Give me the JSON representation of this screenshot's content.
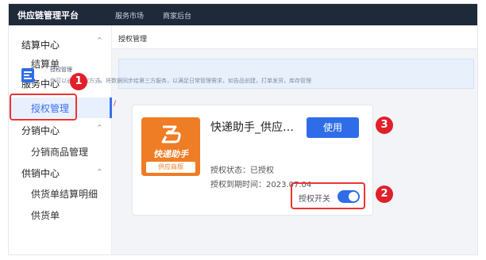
{
  "topbar": {
    "brand": "供应链管理平台",
    "nav": [
      "服务市场",
      "商家后台"
    ]
  },
  "sidebar": {
    "groups": [
      {
        "label": "结算中心",
        "children": [
          "结算单"
        ]
      },
      {
        "label": "服务中心",
        "children": [
          "授权管理"
        ]
      },
      {
        "label": "分销中心",
        "children": [
          "分销商品管理"
        ]
      },
      {
        "label": "供销中心",
        "children": [
          "供货单结算明细",
          "供货单"
        ]
      }
    ],
    "active_item": "授权管理"
  },
  "page": {
    "title": "授权管理"
  },
  "notice": {
    "title": "授权管理",
    "desc": "你可以通过授权方式，将数据同步给第三方服务，以满足日常管理需求，如告品创建，打单发货，库存管理"
  },
  "app_card": {
    "name": "快递助手_供应…",
    "logo_text": "快递助手",
    "logo_tag": "供应商版",
    "use_button": "使用",
    "status_label": "授权状态：",
    "status_value": "已授权",
    "expire_label": "授权到期时间：",
    "expire_value": "2023.07.04",
    "switch_label": "授权开关",
    "switch_on": true
  },
  "annotations": {
    "badges": [
      "1",
      "2",
      "3"
    ],
    "highlight_color": "#e33333"
  },
  "colors": {
    "topbar": "#1e2a3a",
    "primary": "#2f6de8",
    "logo_orange": "#ef7d25"
  }
}
